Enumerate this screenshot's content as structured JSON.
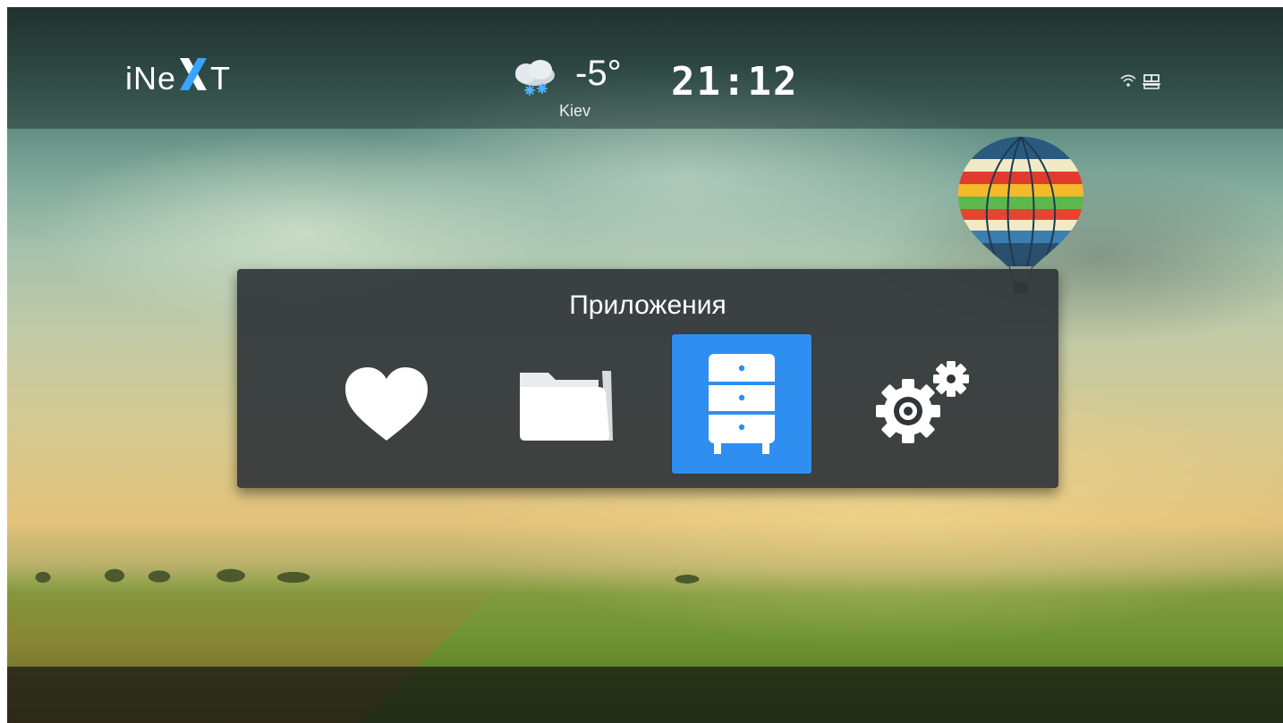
{
  "header": {
    "logo_text": "iNeXT",
    "weather": {
      "icon": "snow-cloud-icon",
      "temperature": "-5°",
      "city": "Kiev"
    },
    "clock": "21:12",
    "status_icons": [
      "wifi-icon",
      "network-icon"
    ]
  },
  "panel": {
    "title": "Приложения",
    "apps": [
      {
        "icon": "heart-icon",
        "name": "favorites",
        "selected": false
      },
      {
        "icon": "folder-icon",
        "name": "files",
        "selected": false
      },
      {
        "icon": "drawer-icon",
        "name": "apps-cabinet",
        "selected": true
      },
      {
        "icon": "gears-icon",
        "name": "settings",
        "selected": false
      }
    ]
  },
  "colors": {
    "accent": "#2f8ff0",
    "panel_bg": "#30353a",
    "text": "#ffffff"
  }
}
